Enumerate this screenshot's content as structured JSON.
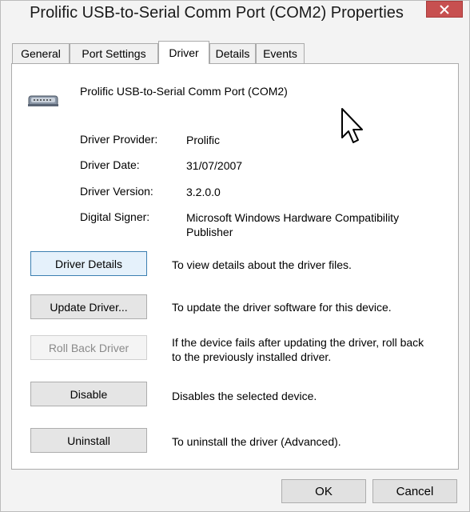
{
  "window": {
    "title": "Prolific USB-to-Serial Comm Port (COM2) Properties"
  },
  "tabs": [
    {
      "label": "General"
    },
    {
      "label": "Port Settings"
    },
    {
      "label": "Driver"
    },
    {
      "label": "Details"
    },
    {
      "label": "Events"
    }
  ],
  "active_tab": "Driver",
  "device": {
    "name": "Prolific USB-to-Serial Comm Port (COM2)",
    "icon": "serial-port-icon"
  },
  "driver_info": {
    "provider_label": "Driver Provider:",
    "provider_value": "Prolific",
    "date_label": "Driver Date:",
    "date_value": "31/07/2007",
    "version_label": "Driver Version:",
    "version_value": "3.2.0.0",
    "signer_label": "Digital Signer:",
    "signer_value": "Microsoft Windows Hardware Compatibility Publisher"
  },
  "actions": [
    {
      "label": "Driver Details",
      "description": "To view details about the driver files."
    },
    {
      "label": "Update Driver...",
      "description": "To update the driver software for this device."
    },
    {
      "label": "Roll Back Driver",
      "description": "If the device fails after updating the driver, roll back to the previously installed driver."
    },
    {
      "label": "Disable",
      "description": "Disables the selected device."
    },
    {
      "label": "Uninstall",
      "description": "To uninstall the driver (Advanced)."
    }
  ],
  "footer": {
    "ok_label": "OK",
    "cancel_label": "Cancel"
  },
  "colors": {
    "close_button": "#c75050",
    "focus_border": "#3c7fb1",
    "disabled_text": "#8a8a8a"
  }
}
